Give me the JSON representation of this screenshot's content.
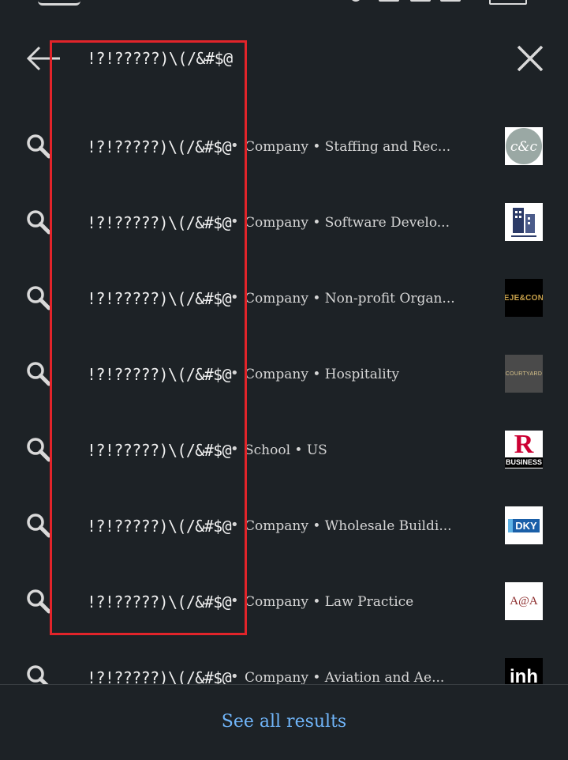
{
  "query": "!?!?????)\\(/&#$@",
  "results": [
    {
      "name": "!?!?????)\\(/&#$@",
      "meta": "Company • Staffing and Rec...",
      "logo": {
        "type": "circle-monogram",
        "text": "c&c",
        "bg": "#ffffff",
        "fg": "#ffffff",
        "accent": "#9aa8a4"
      }
    },
    {
      "name": "!?!?????)\\(/&#$@",
      "meta": "Company • Software Develo...",
      "logo": {
        "type": "building",
        "text": "",
        "bg": "#ffffff",
        "fg": "#2b3a67",
        "accent": "#2b3a67"
      }
    },
    {
      "name": "!?!?????)\\(/&#$@",
      "meta": "Company • Non-profit Organ...",
      "logo": {
        "type": "wordmark",
        "text": "EJE&CON",
        "bg": "#000000",
        "fg": "#c9a24b",
        "accent": "#c9a24b"
      }
    },
    {
      "name": "!?!?????)\\(/&#$@",
      "meta": "Company • Hospitality",
      "logo": {
        "type": "wordmark-small",
        "text": "COURTYARD",
        "bg": "#4a4a4a",
        "fg": "#d8c38a",
        "accent": "#d8c38a"
      }
    },
    {
      "name": "!?!?????)\\(/&#$@",
      "meta": "School • US",
      "logo": {
        "type": "r-business",
        "text": "R",
        "subtext": "BUSINESS",
        "bg": "#ffffff",
        "fg": "#cc0033",
        "accent": "#000000"
      }
    },
    {
      "name": "!?!?????)\\(/&#$@",
      "meta": "Company • Wholesale Buildi...",
      "logo": {
        "type": "wordmark",
        "text": "DKY",
        "bg": "#ffffff",
        "fg": "#1a5fa8",
        "accent": "#1a5fa8"
      }
    },
    {
      "name": "!?!?????)\\(/&#$@",
      "meta": "Company • Law Practice",
      "logo": {
        "type": "wordmark-serif",
        "text": "A@A",
        "bg": "#ffffff",
        "fg": "#8b2a2a",
        "accent": "#8b2a2a"
      }
    },
    {
      "name": "!?!?????)\\(/&#$@",
      "meta": "Company • Aviation and Ae...",
      "logo": {
        "type": "wordmark-bold",
        "text": "inh",
        "bg": "#000000",
        "fg": "#ffffff",
        "accent": "#ffffff"
      }
    }
  ],
  "footer": {
    "see_all_label": "See all results"
  },
  "colors": {
    "background": "#1d2226",
    "link": "#70b5f9",
    "highlight": "#e2242a"
  },
  "icons": {
    "back": "arrow-left-icon",
    "close": "close-icon",
    "search": "search-icon"
  }
}
